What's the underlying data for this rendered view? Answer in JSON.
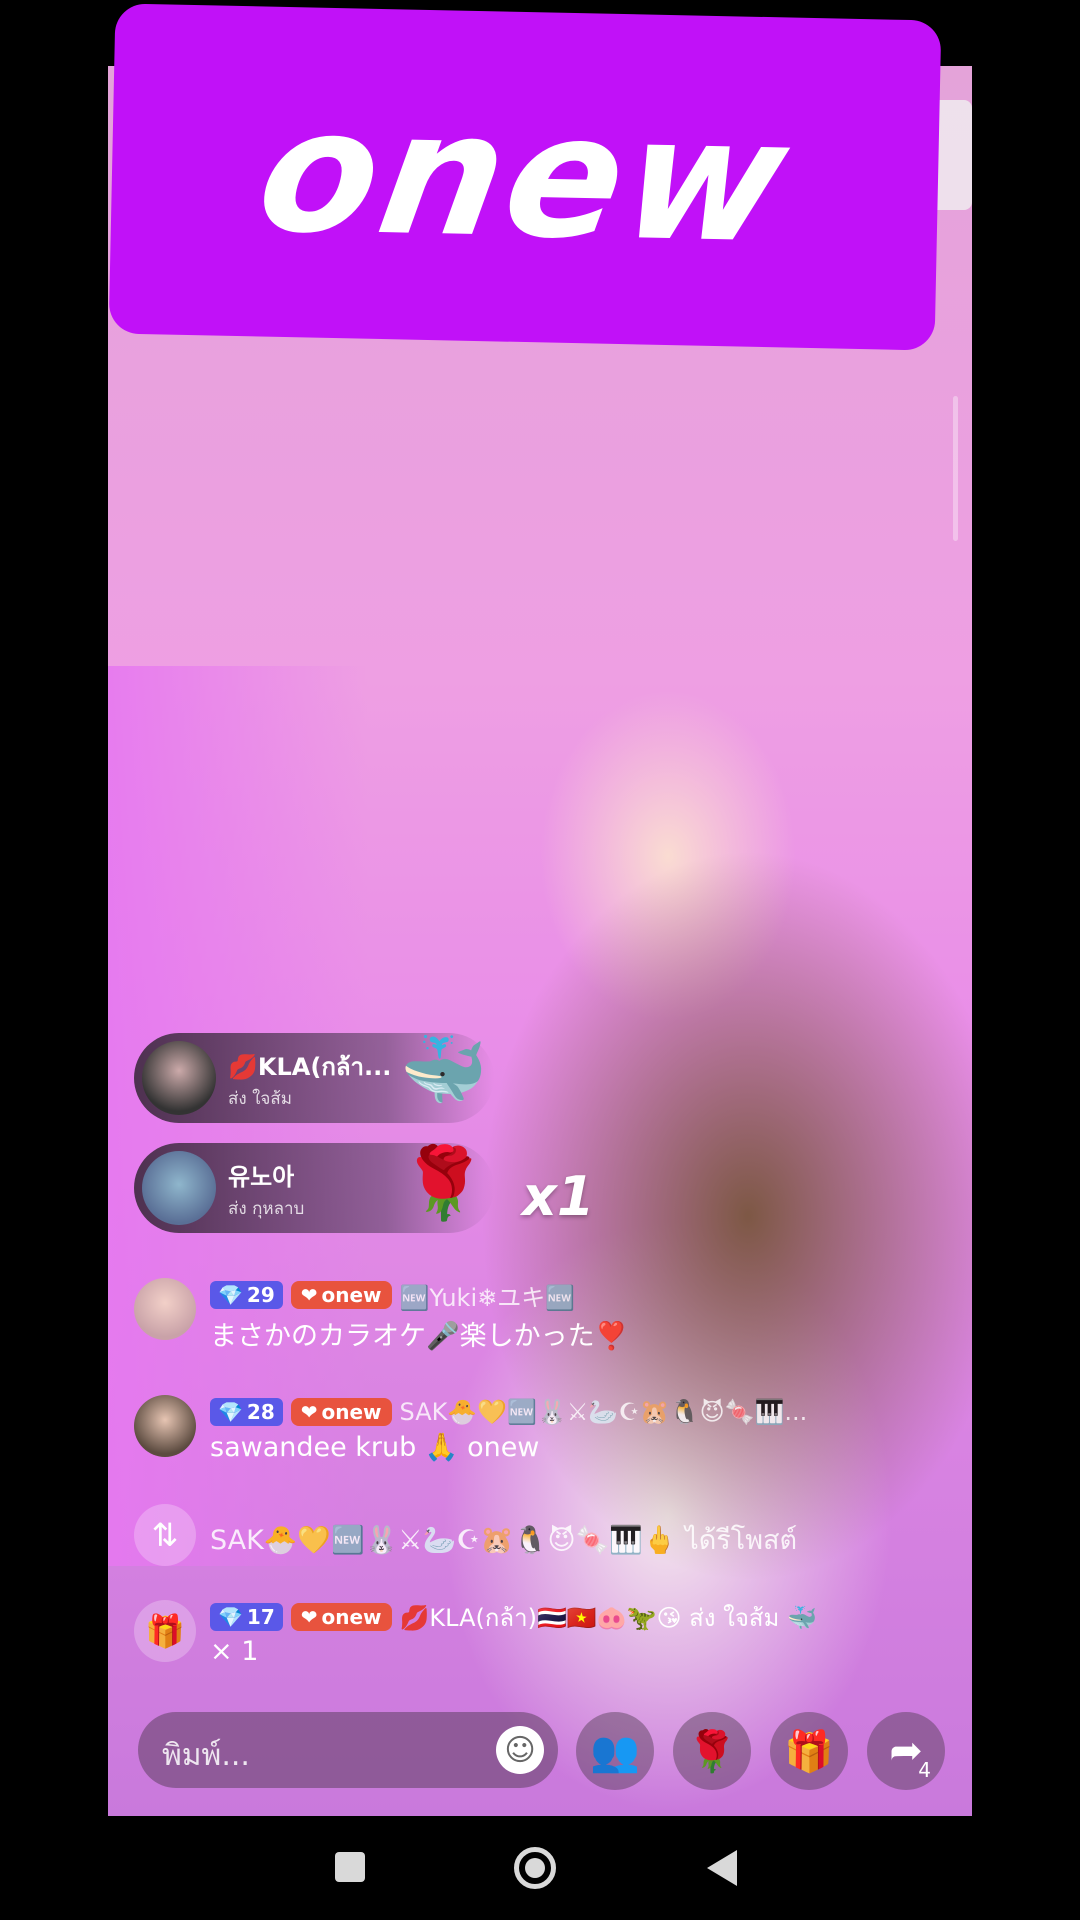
{
  "logo": {
    "text": "onew",
    "color": "#c111f8"
  },
  "gifts": [
    {
      "user": "💋KLA(กล้า...",
      "action": "ส่ง ใจส้ม",
      "item_icon": "🐳"
    },
    {
      "user": "유노아",
      "action": "ส่ง กุหลาบ",
      "item_icon": "🌹",
      "count": "x1"
    }
  ],
  "chat": [
    {
      "level": "29",
      "fan_badge": "onew",
      "user": "🆕Yuki❄ユキ🆕",
      "message": "まさかのカラオケ🎤楽しかった❣️"
    },
    {
      "level": "28",
      "fan_badge": "onew",
      "user": "SAK🐣💛🆕🐰⚔🦢☪🐹🐧😈🍬🎹...",
      "message": "sawandee krub 🙏 onew"
    },
    {
      "type": "repost",
      "icon": "repost-icon",
      "text": "SAK🐣💛🆕🐰⚔🦢☪🐹🐧😈🍬🎹🖕 ได้รีโพสต์"
    },
    {
      "type": "gift",
      "icon": "gift-icon",
      "level": "17",
      "fan_badge": "onew",
      "text": "💋KLA(กล้า)🇹🇭🇻🇳🐽🦖😘 ส่ง ใจส้ม 🐳",
      "count": "× 1"
    }
  ],
  "bottom_bar": {
    "input_placeholder": "พิมพ์...",
    "share_count": "4"
  }
}
